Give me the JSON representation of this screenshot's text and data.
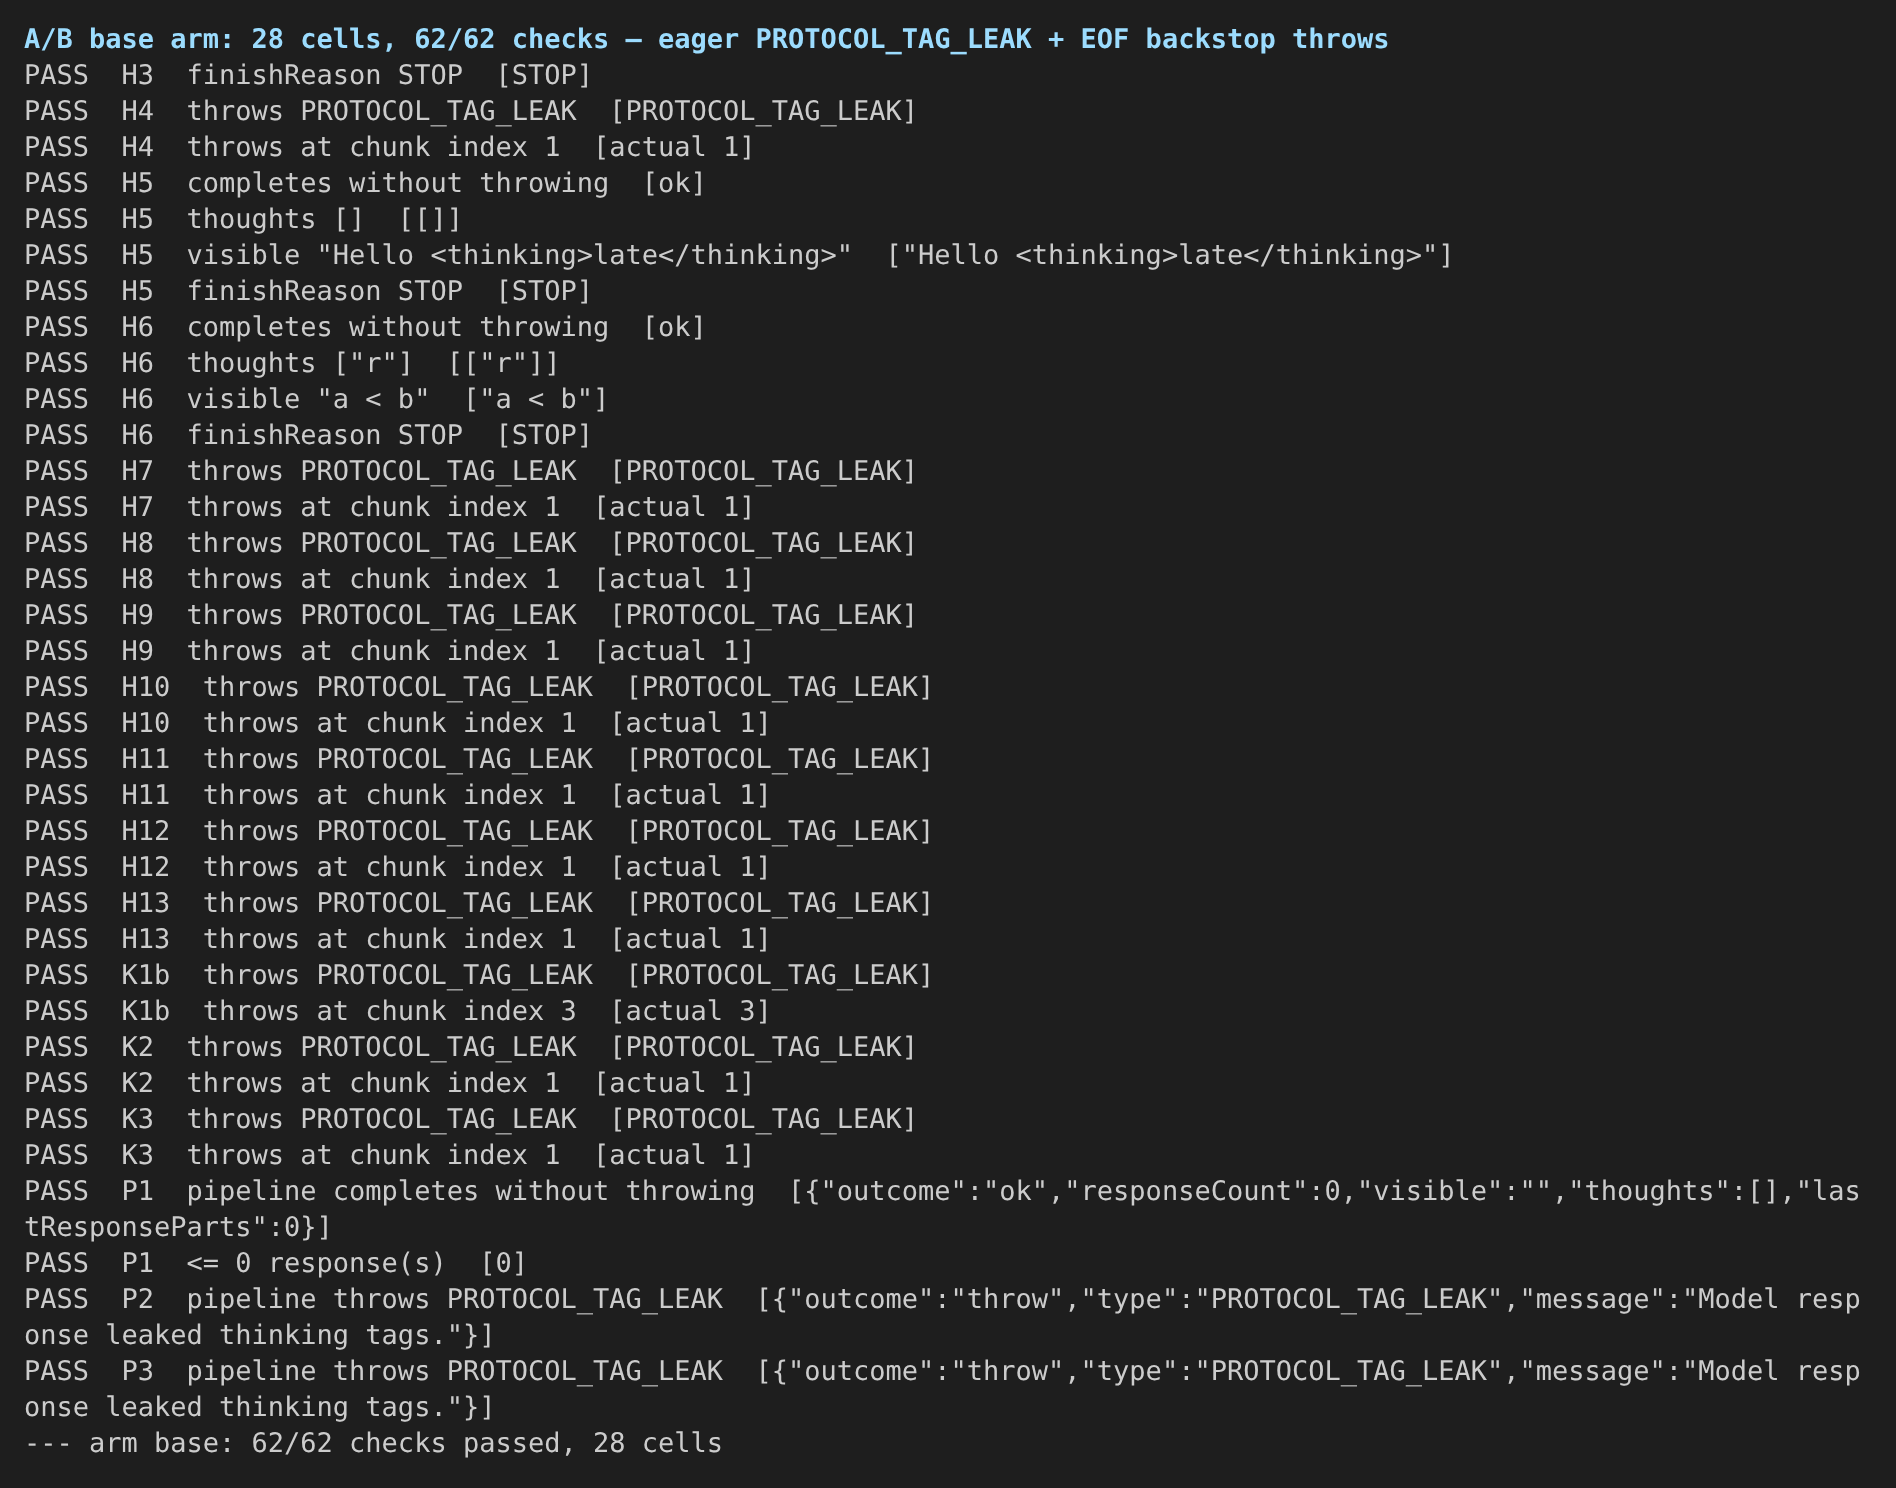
{
  "header": "A/B base arm: 28 cells, 62/62 checks — eager PROTOCOL_TAG_LEAK + EOF backstop throws",
  "lines": [
    "PASS  H3  finishReason STOP  [STOP]",
    "PASS  H4  throws PROTOCOL_TAG_LEAK  [PROTOCOL_TAG_LEAK]",
    "PASS  H4  throws at chunk index 1  [actual 1]",
    "PASS  H5  completes without throwing  [ok]",
    "PASS  H5  thoughts []  [[]]",
    "PASS  H5  visible \"Hello <thinking>late</thinking>\"  [\"Hello <thinking>late</thinking>\"]",
    "PASS  H5  finishReason STOP  [STOP]",
    "PASS  H6  completes without throwing  [ok]",
    "PASS  H6  thoughts [\"r\"]  [[\"r\"]]",
    "PASS  H6  visible \"a < b\"  [\"a < b\"]",
    "PASS  H6  finishReason STOP  [STOP]",
    "PASS  H7  throws PROTOCOL_TAG_LEAK  [PROTOCOL_TAG_LEAK]",
    "PASS  H7  throws at chunk index 1  [actual 1]",
    "PASS  H8  throws PROTOCOL_TAG_LEAK  [PROTOCOL_TAG_LEAK]",
    "PASS  H8  throws at chunk index 1  [actual 1]",
    "PASS  H9  throws PROTOCOL_TAG_LEAK  [PROTOCOL_TAG_LEAK]",
    "PASS  H9  throws at chunk index 1  [actual 1]",
    "PASS  H10  throws PROTOCOL_TAG_LEAK  [PROTOCOL_TAG_LEAK]",
    "PASS  H10  throws at chunk index 1  [actual 1]",
    "PASS  H11  throws PROTOCOL_TAG_LEAK  [PROTOCOL_TAG_LEAK]",
    "PASS  H11  throws at chunk index 1  [actual 1]",
    "PASS  H12  throws PROTOCOL_TAG_LEAK  [PROTOCOL_TAG_LEAK]",
    "PASS  H12  throws at chunk index 1  [actual 1]",
    "PASS  H13  throws PROTOCOL_TAG_LEAK  [PROTOCOL_TAG_LEAK]",
    "PASS  H13  throws at chunk index 1  [actual 1]",
    "PASS  K1b  throws PROTOCOL_TAG_LEAK  [PROTOCOL_TAG_LEAK]",
    "PASS  K1b  throws at chunk index 3  [actual 3]",
    "PASS  K2  throws PROTOCOL_TAG_LEAK  [PROTOCOL_TAG_LEAK]",
    "PASS  K2  throws at chunk index 1  [actual 1]",
    "PASS  K3  throws PROTOCOL_TAG_LEAK  [PROTOCOL_TAG_LEAK]",
    "PASS  K3  throws at chunk index 1  [actual 1]",
    "PASS  P1  pipeline completes without throwing  [{\"outcome\":\"ok\",\"responseCount\":0,\"visible\":\"\",\"thoughts\":[],\"lastResponseParts\":0}]",
    "PASS  P1  <= 0 response(s)  [0]",
    "PASS  P2  pipeline throws PROTOCOL_TAG_LEAK  [{\"outcome\":\"throw\",\"type\":\"PROTOCOL_TAG_LEAK\",\"message\":\"Model response leaked thinking tags.\"}]",
    "PASS  P3  pipeline throws PROTOCOL_TAG_LEAK  [{\"outcome\":\"throw\",\"type\":\"PROTOCOL_TAG_LEAK\",\"message\":\"Model response leaked thinking tags.\"}]"
  ],
  "summary": "--- arm base: 62/62 checks passed, 28 cells"
}
